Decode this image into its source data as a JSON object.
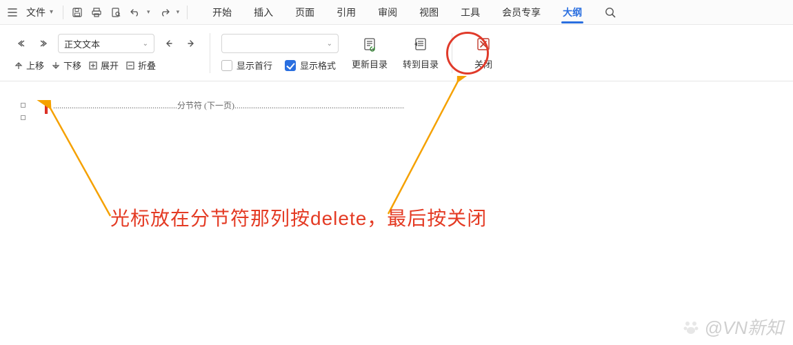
{
  "file_menu_label": "文件",
  "tabs": [
    "开始",
    "插入",
    "页面",
    "引用",
    "审阅",
    "视图",
    "工具",
    "会员专享",
    "大纲"
  ],
  "active_tab_index": 8,
  "outline": {
    "level_select_value": "正文文本",
    "move_up": "上移",
    "move_down": "下移",
    "expand": "展开",
    "collapse": "折叠",
    "show_first_line": "显示首行",
    "show_format": "显示格式",
    "show_first_line_checked": false,
    "show_format_checked": true,
    "update_toc": "更新目录",
    "goto_toc": "转到目录",
    "close": "关闭"
  },
  "doc": {
    "section_break_label": "分节符 (下一页)"
  },
  "annotation": "光标放在分节符那列按delete，最后按关闭",
  "watermark_text": "@VN新知"
}
